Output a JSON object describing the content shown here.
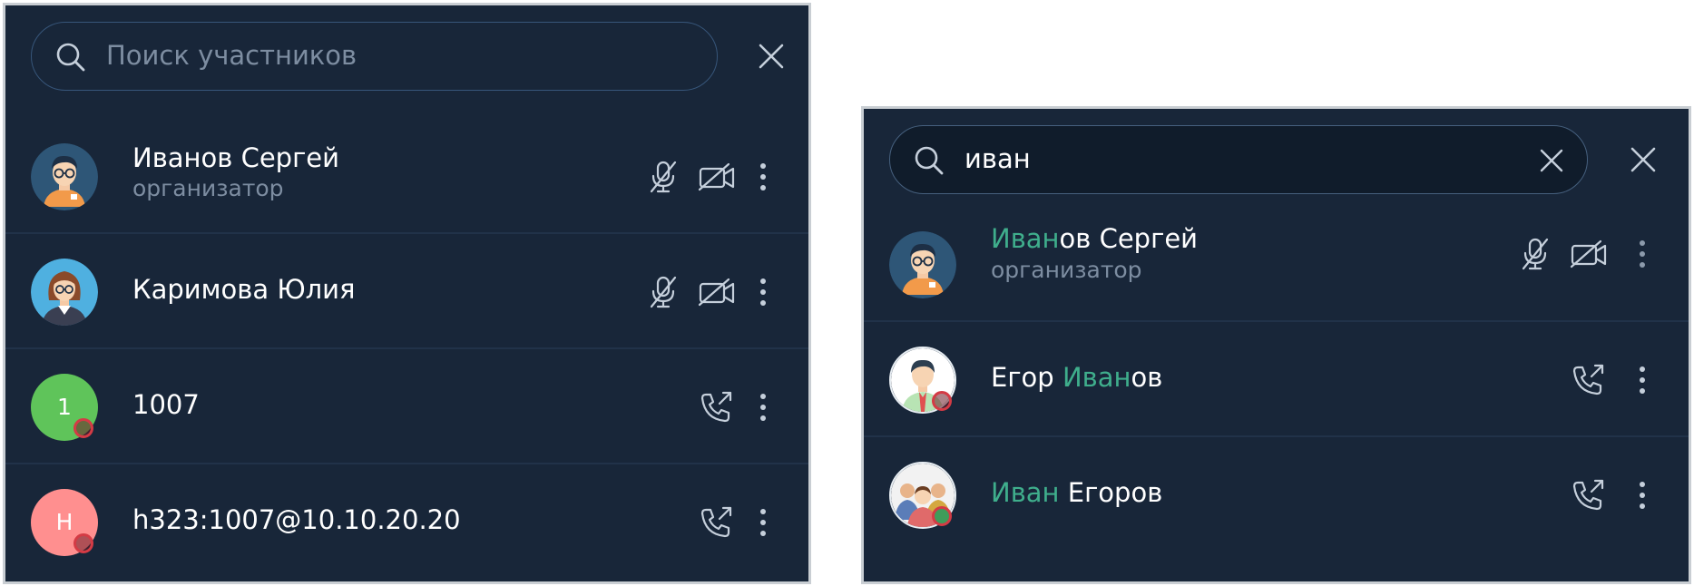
{
  "left_panel": {
    "search": {
      "placeholder": "Поиск участников",
      "value": ""
    },
    "participants": [
      {
        "name": "Иванов Сергей",
        "role": "организатор",
        "avatar": "male-glasses-avatar",
        "actions": [
          "mic-off-icon",
          "camera-off-icon",
          "more-vertical-icon"
        ]
      },
      {
        "name": "Каримова Юлия",
        "avatar": "female-glasses-avatar",
        "actions": [
          "mic-off-icon",
          "camera-off-icon",
          "more-vertical-icon"
        ]
      },
      {
        "name": "1007",
        "avatar_letter": "1",
        "avatar_color": "#5fc45a",
        "status": "offline",
        "actions": [
          "call-icon",
          "more-vertical-icon"
        ]
      },
      {
        "name": "h323:1007@10.10.20.20",
        "avatar_letter": "H",
        "avatar_color": "#ff8f8f",
        "status": "offline",
        "actions": [
          "call-icon",
          "more-vertical-icon"
        ]
      }
    ]
  },
  "right_panel": {
    "search": {
      "value": "иван"
    },
    "participants": [
      {
        "name_parts": [
          "Иван",
          "ов Сергей"
        ],
        "role": "организатор",
        "avatar": "male-glasses-avatar",
        "actions": [
          "mic-off-icon",
          "camera-off-icon",
          "more-vertical-icon"
        ]
      },
      {
        "name_parts": [
          "Егор ",
          "Иван",
          "ов"
        ],
        "avatar": "male-tie-avatar",
        "status": "offline",
        "actions": [
          "call-icon",
          "more-vertical-icon"
        ]
      },
      {
        "name_parts": [
          "Иван",
          " Егоров"
        ],
        "avatar": "group-avatar",
        "status": "offline",
        "actions": [
          "call-icon",
          "more-vertical-icon"
        ]
      }
    ]
  },
  "colors": {
    "background": "#182639",
    "highlight": "#3fae8c",
    "muted_text": "#7d8da1",
    "status_offline": "#d43b45"
  }
}
